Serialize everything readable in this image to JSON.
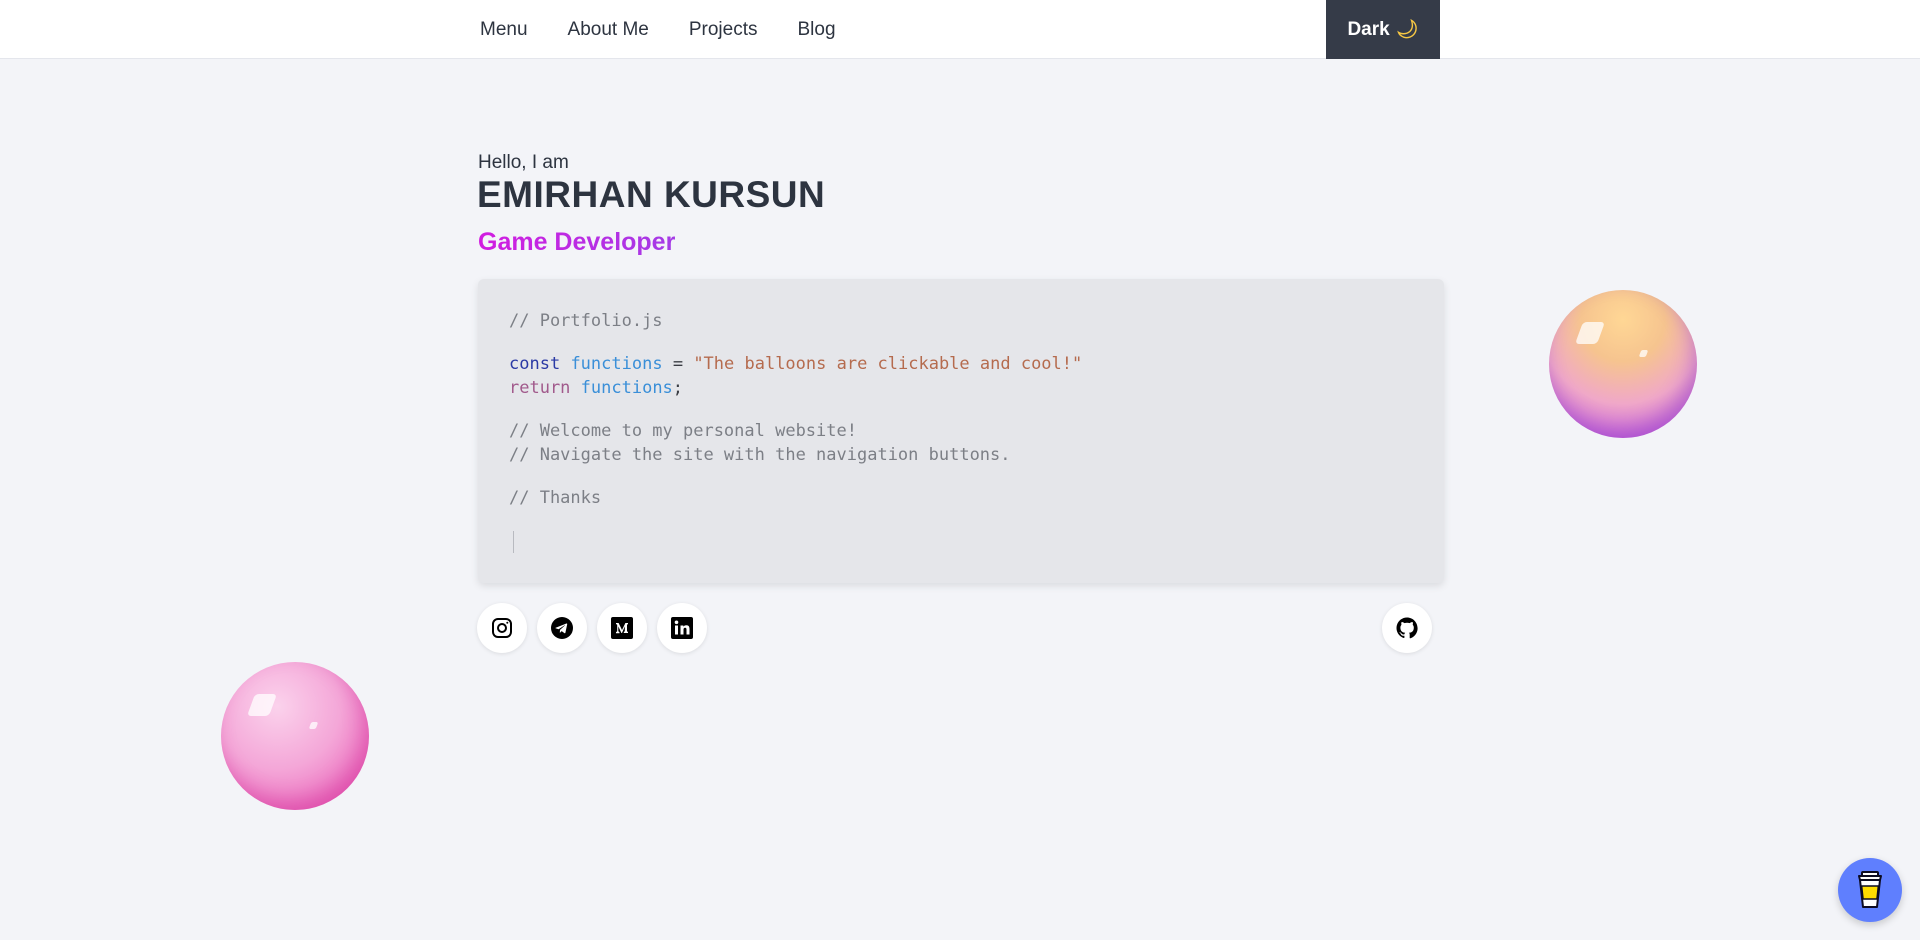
{
  "nav": {
    "items": [
      "Menu",
      "About Me",
      "Projects",
      "Blog"
    ],
    "theme_toggle": "Dark",
    "theme_icon": "moon-icon"
  },
  "hero": {
    "greeting": "Hello, I am",
    "name": "EMIRHAN KURSUN",
    "role": "Game Developer",
    "role_gradient": [
      "#d21ce0",
      "#a43be6"
    ]
  },
  "code": {
    "comment_file": "// Portfolio.js",
    "kw_const": "const",
    "ident": "functions",
    "op_eq": "=",
    "string": "\"The balloons are clickable and cool!\"",
    "kw_return": "return",
    "semicolon": ";",
    "comment_welcome": "// Welcome to my personal website!",
    "comment_navigate": "// Navigate the site with the navigation buttons.",
    "comment_thanks": "// Thanks"
  },
  "social": [
    "instagram-icon",
    "telegram-icon",
    "medium-icon",
    "linkedin-icon",
    "github-icon"
  ],
  "colors": {
    "background": "#f3f4f8",
    "toggle_bg": "#353b48",
    "coffee_bg": "#5f7ffe"
  }
}
